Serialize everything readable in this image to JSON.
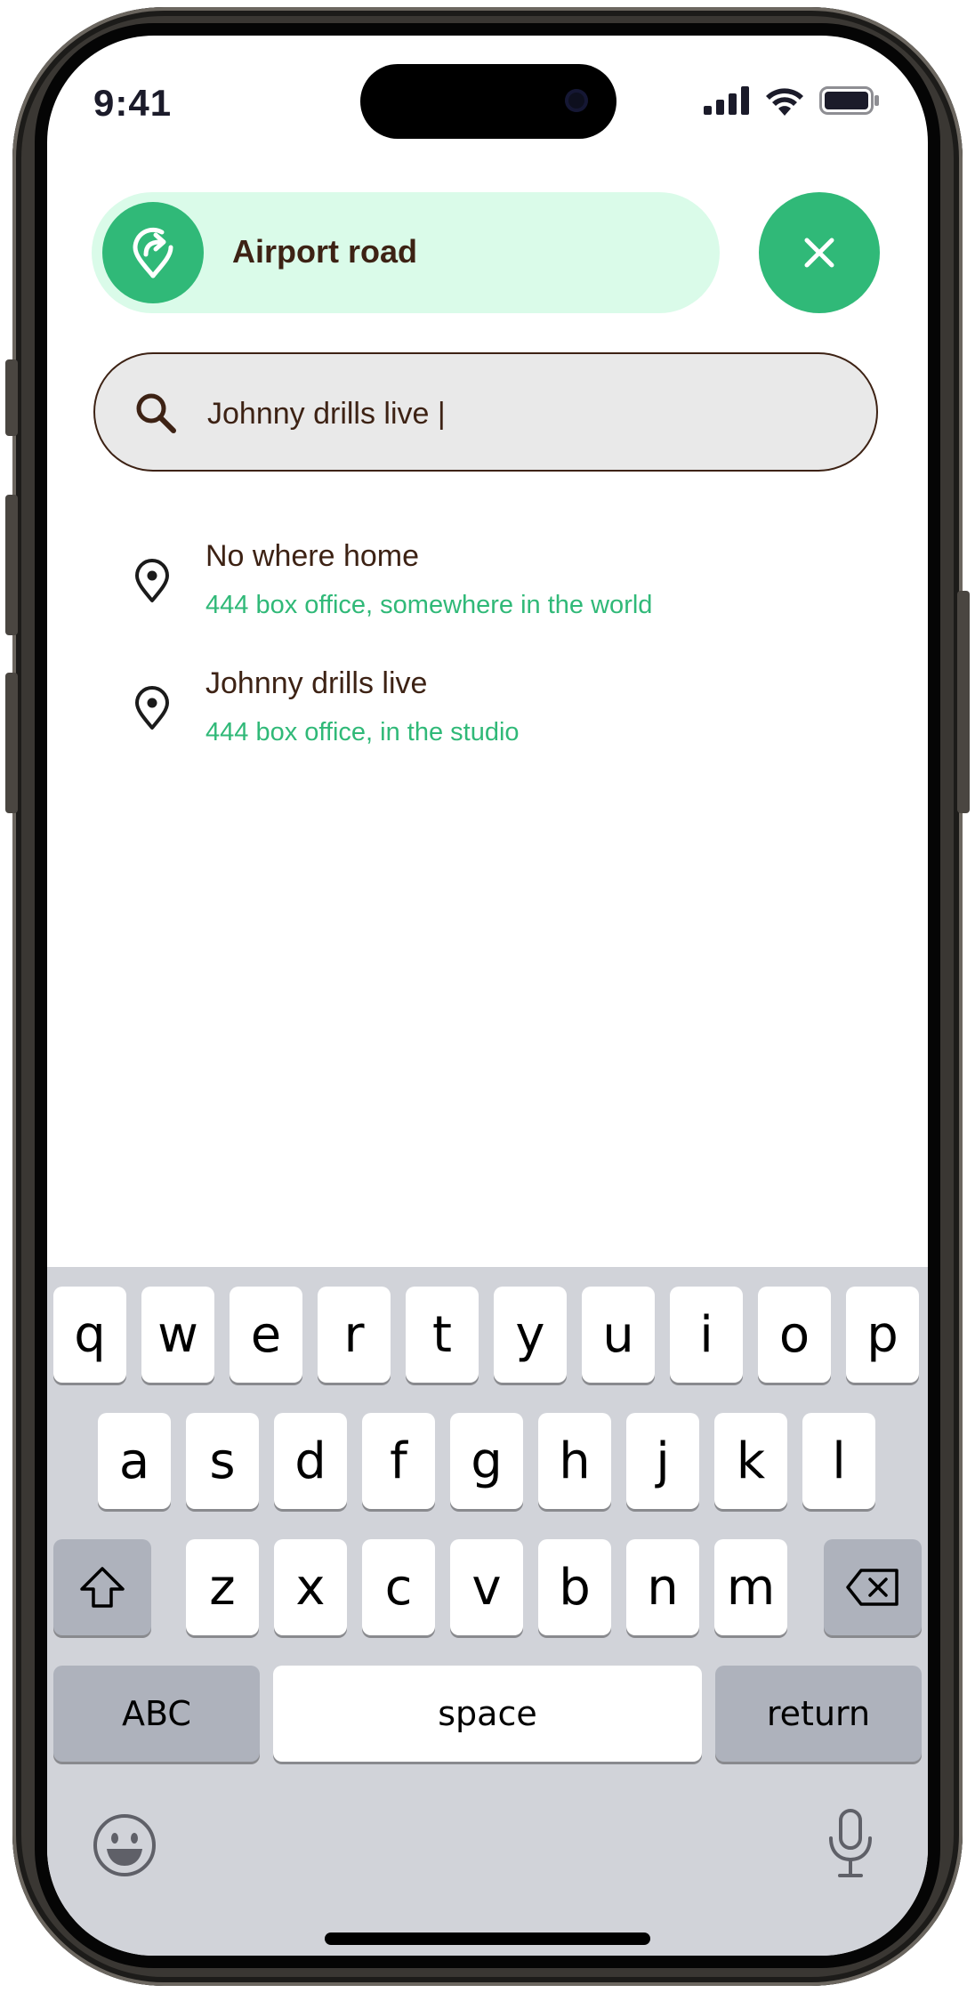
{
  "status_bar": {
    "time": "9:41"
  },
  "route": {
    "label": "Airport road",
    "icon": "directions-pin-icon"
  },
  "close": {
    "icon": "close-icon"
  },
  "search": {
    "icon": "search-icon",
    "value": "Johnny drills live |"
  },
  "results": [
    {
      "title": "No where home",
      "subtitle": "444 box office, somewhere in the world",
      "icon": "location-pin-icon"
    },
    {
      "title": "Johnny drills live",
      "subtitle": "444 box office, in the studio",
      "icon": "location-pin-icon"
    }
  ],
  "keyboard": {
    "row1": [
      "q",
      "w",
      "e",
      "r",
      "t",
      "y",
      "u",
      "i",
      "o",
      "p"
    ],
    "row2": [
      "a",
      "s",
      "d",
      "f",
      "g",
      "h",
      "j",
      "k",
      "l"
    ],
    "row3": [
      "z",
      "x",
      "c",
      "v",
      "b",
      "n",
      "m"
    ],
    "abc_label": "ABC",
    "space_label": "space",
    "return_label": "return"
  },
  "colors": {
    "accent": "#30b978",
    "accent_light": "#dafbe9",
    "text_dark": "#3d2214"
  }
}
